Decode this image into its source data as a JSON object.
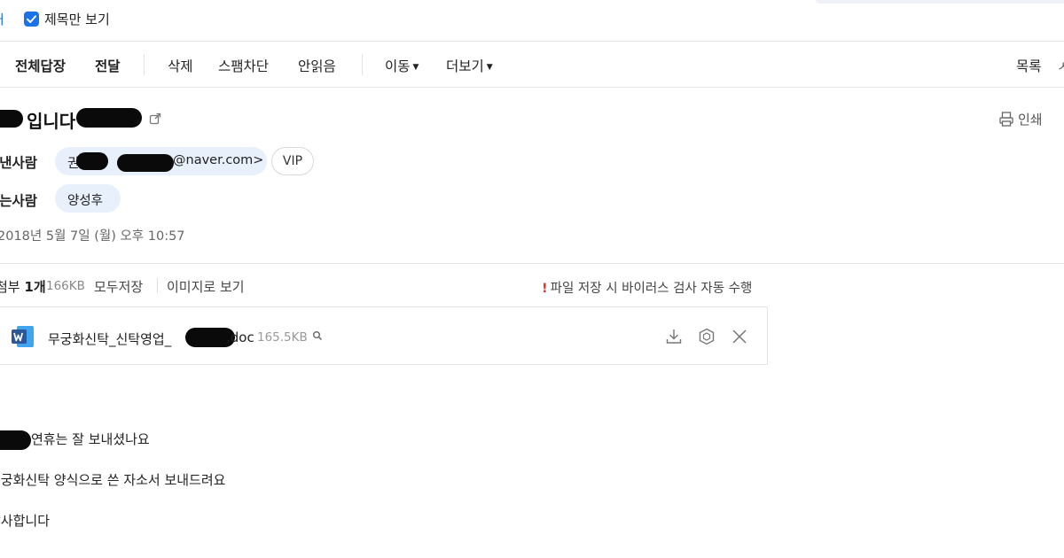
{
  "topbar": {
    "left_edge_char": "ㅓ",
    "title_only_checkbox_label": "제목만 보기",
    "title_only_checked": true
  },
  "toolbar": {
    "reply_all": "전체답장",
    "forward": "전달",
    "delete": "삭제",
    "spam_block": "스팸차단",
    "mark_unread": "안읽음",
    "move": "이동",
    "more": "더보기",
    "list": "목록",
    "right_edge_char": "ㅅ"
  },
  "mail": {
    "subject_visible": "입니다",
    "subject_trailing": ".",
    "print_label": "인쇄",
    "sender_label": "보낸사람",
    "sender_name_visible": "권",
    "sender_email_suffix": "@naver.com>",
    "vip_label": "VIP",
    "recipient_label": "받는사람",
    "recipient": "양성후",
    "date": "2018년 5월 7일 (월) 오후 10:57"
  },
  "attachments": {
    "count_prefix": "첨부",
    "count": "1개",
    "total_size": "166KB",
    "save_all": "모두저장",
    "view_as_image": "이미지로 보기",
    "virus_notice": "파일 저장 시 바이러스 검사 자동 수행",
    "files": [
      {
        "name_prefix": "무궁화신탁_신탁영업_",
        "name_suffix": ".doc",
        "size": "165.5KB",
        "icon": "word-icon"
      }
    ]
  },
  "body": {
    "lines": [
      "연휴는 잘 보내셨나요",
      "무궁화신탁 양식으로 쓴 자소서 보내드려요",
      "감사합니다"
    ]
  },
  "colors": {
    "accent": "#1a73e8",
    "pill_bg": "#e8f0fb",
    "warning": "#e0352b",
    "word_blue": "#2b579a"
  }
}
